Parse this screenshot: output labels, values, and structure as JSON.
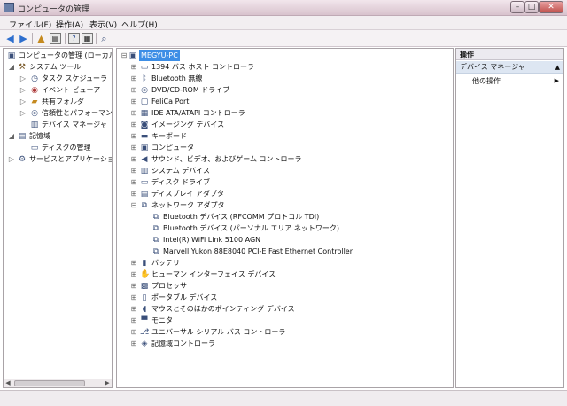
{
  "window": {
    "title": "コンピュータの管理"
  },
  "menu": [
    {
      "label": "ファイル(F)"
    },
    {
      "label": "操作(A)"
    },
    {
      "label": "表示(V)"
    },
    {
      "label": "ヘルプ(H)"
    }
  ],
  "left_tree": {
    "root": "コンピュータの管理 (ローカル",
    "system_tools": "システム ツール",
    "task_scheduler": "タスク スケジューラ",
    "event_viewer": "イベント ビューア",
    "shared_folders": "共有フォルダ",
    "reliability": "信頼性とパフォーマンス",
    "device_manager": "デバイス マネージャ",
    "storage": "記憶域",
    "disk_management": "ディスクの管理",
    "services": "サービスとアプリケーション"
  },
  "device_tree": {
    "computer_name": "MEGYU-PC",
    "categories": [
      {
        "label": "1394 バス ホスト コントローラ",
        "icon": "1394-icon"
      },
      {
        "label": "Bluetooth 無線",
        "icon": "bluetooth-icon"
      },
      {
        "label": "DVD/CD-ROM ドライブ",
        "icon": "dvd-icon"
      },
      {
        "label": "FeliCa Port",
        "icon": "felica-icon"
      },
      {
        "label": "IDE ATA/ATAPI コントローラ",
        "icon": "ide-icon"
      },
      {
        "label": "イメージング デバイス",
        "icon": "camera-icon"
      },
      {
        "label": "キーボード",
        "icon": "keyboard-icon"
      },
      {
        "label": "コンピュータ",
        "icon": "computer-icon"
      },
      {
        "label": "サウンド、ビデオ、およびゲーム コントローラ",
        "icon": "speaker-icon"
      },
      {
        "label": "システム デバイス",
        "icon": "system-device-icon"
      },
      {
        "label": "ディスク ドライブ",
        "icon": "disk-drive-icon"
      },
      {
        "label": "ディスプレイ アダプタ",
        "icon": "display-adapter-icon"
      }
    ],
    "network": {
      "label": "ネットワーク アダプタ",
      "children": [
        {
          "label": "Bluetooth デバイス (RFCOMM プロトコル TDI)"
        },
        {
          "label": "Bluetooth デバイス (パーソナル エリア ネットワーク)"
        },
        {
          "label": "Intel(R) WiFi Link 5100 AGN"
        },
        {
          "label": "Marvell Yukon 88E8040 PCI-E Fast Ethernet Controller"
        }
      ]
    },
    "categories_after": [
      {
        "label": "バッテリ",
        "icon": "battery-icon"
      },
      {
        "label": "ヒューマン インターフェイス デバイス",
        "icon": "hid-icon"
      },
      {
        "label": "プロセッサ",
        "icon": "processor-icon"
      },
      {
        "label": "ポータブル デバイス",
        "icon": "portable-device-icon"
      },
      {
        "label": "マウスとそのほかのポインティング デバイス",
        "icon": "mouse-icon"
      },
      {
        "label": "モニタ",
        "icon": "monitor-icon"
      },
      {
        "label": "ユニバーサル シリアル バス コントローラ",
        "icon": "usb-icon"
      },
      {
        "label": "記憶域コントローラ",
        "icon": "storage-controller-icon"
      }
    ]
  },
  "actions": {
    "header": "操作",
    "section": "デバイス マネージャ",
    "other": "他の操作"
  }
}
